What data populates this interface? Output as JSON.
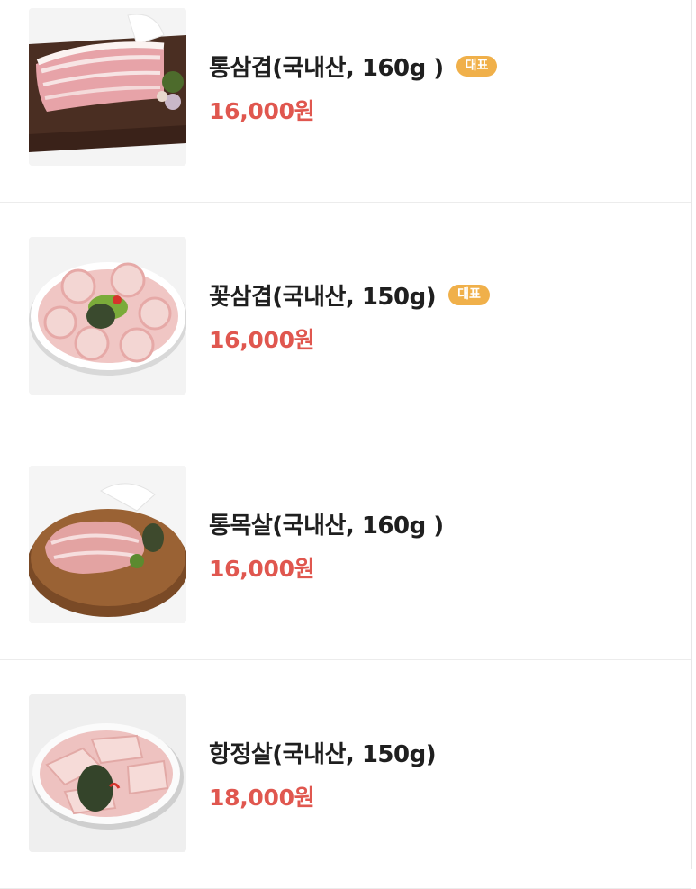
{
  "items": [
    {
      "name": "통삼겹(국내산, 160g )",
      "price": "16,000원",
      "badge": "대표",
      "image_icon": "pork-belly-block-on-board-image"
    },
    {
      "name": "꽃삼겹(국내산, 150g)",
      "price": "16,000원",
      "badge": "대표",
      "image_icon": "sliced-pork-belly-plate-image"
    },
    {
      "name": "통목살(국내산, 160g )",
      "price": "16,000원",
      "badge": "",
      "image_icon": "pork-neck-on-round-board-image"
    },
    {
      "name": "항정살(국내산, 150g)",
      "price": "18,000원",
      "badge": "",
      "image_icon": "pork-jowl-plate-image"
    }
  ],
  "colors": {
    "price": "#e0574f",
    "badge_bg": "#f0b04a",
    "name": "#1f1f1f",
    "divider": "#ececec"
  }
}
